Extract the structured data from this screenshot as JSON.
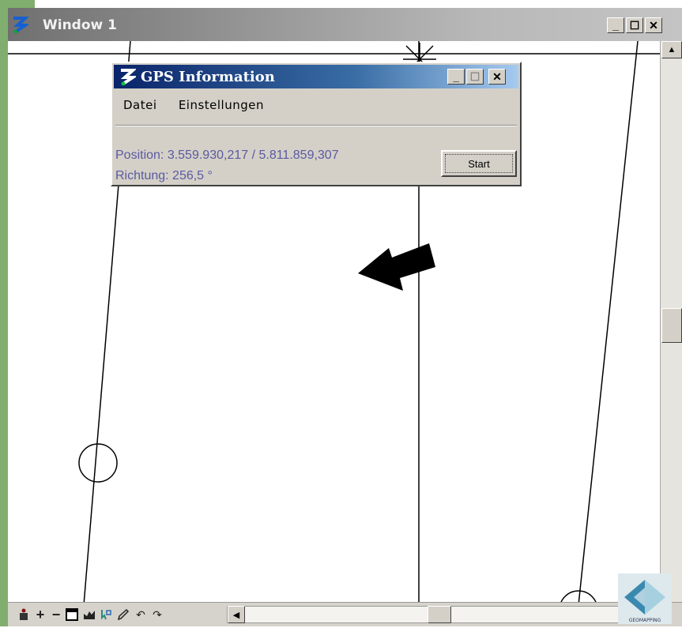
{
  "main_window": {
    "title": "Window 1",
    "buttons": [
      "minimize",
      "maximize",
      "close"
    ]
  },
  "gps_dialog": {
    "title": "GPS Information",
    "menu": [
      "Datei",
      "Einstellungen"
    ],
    "position_text": "Position: 3.559.930,217 / 5.811.859,307",
    "direction_text": "Richtung: 256,5 °",
    "start_label": "Start"
  },
  "toolbar": {
    "tools": [
      "person-icon",
      "zoom-in-icon",
      "zoom-out-icon",
      "window-icon",
      "pan-icon",
      "select-icon",
      "pen-icon",
      "undo-icon",
      "redo-icon"
    ]
  },
  "brand": {
    "logo_text": "GEOMAPPING"
  },
  "colors": {
    "title_gradient_start": "#707070",
    "dialog_title_start": "#0a246a",
    "info_text": "#5a5aa0",
    "background_green": "#7fae6e"
  }
}
